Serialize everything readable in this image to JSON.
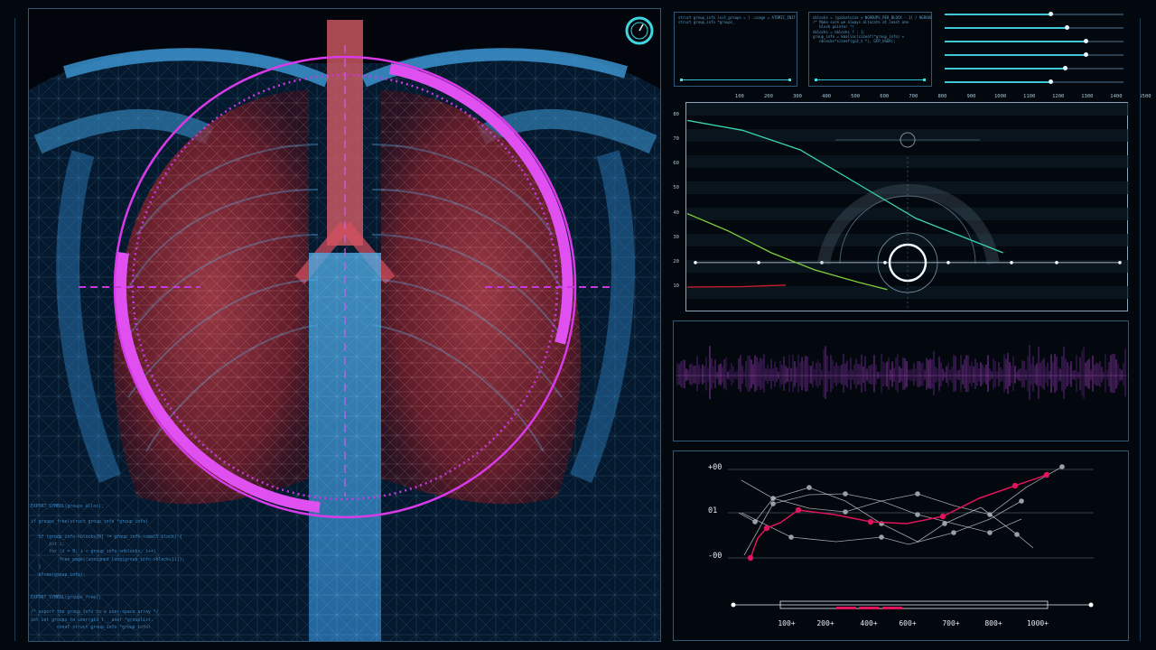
{
  "code": {
    "lines": [
      "EXPORT_SYMBOL(groups_alloc);",
      "",
      "if groups_free(struct group_info *group_info)",
      "",
      "   if (group_info->blocks[0] != group_info->small_block) {",
      "       int i;",
      "       for (i = 0; i < group_info->nblocks; i++)",
      "           free_page((unsigned long)group_info->blocks[i]);",
      "   }",
      "   kfree(group_info);",
      "",
      "",
      "EXPORT_SYMBOL(groups_free);",
      "",
      "/* export the group_info to a user-space array */",
      "int int groups_to_user(gid_t __user *grouplist,",
      "          const struct group_info *group_info)"
    ]
  },
  "terminals": [
    {
      "lines": [
        "struct group_info init_groups = { .usage = ATOMIC_INIT(2) };",
        "struct group_info *groups_"
      ]
    },
    {
      "lines": [
        "nblocks = (gidsetsize + NGROUPS_PER_BLOCK - 1) / NGROUPS_PER_BLOCK;",
        "/* Make sure we always allocate at least one",
        "   block pointer */",
        "nblocks = nblocks ? : 1;",
        "group_info = kmalloc(sizeof(*group_info) +",
        "   nblocks*sizeof(gid_t *), GFP_USER);"
      ]
    }
  ],
  "sliders": [
    0.59,
    0.68,
    0.79,
    0.79,
    0.67,
    0.59
  ],
  "graph": {
    "x_ticks": [
      "100",
      "200",
      "300",
      "400",
      "500",
      "600",
      "700",
      "800",
      "900",
      "1000",
      "1100",
      "1200",
      "1300",
      "1400",
      "1500"
    ],
    "y_ticks": [
      "80",
      "70",
      "60",
      "50",
      "40",
      "30",
      "20",
      "10"
    ],
    "curves": [
      {
        "color": "#38d6b0",
        "points": [
          [
            10,
            78
          ],
          [
            200,
            74
          ],
          [
            400,
            66
          ],
          [
            600,
            52
          ],
          [
            800,
            38
          ],
          [
            1100,
            24
          ]
        ]
      },
      {
        "color": "#7fd13a",
        "points": [
          [
            10,
            40
          ],
          [
            150,
            33
          ],
          [
            300,
            24
          ],
          [
            450,
            17
          ],
          [
            600,
            12
          ],
          [
            700,
            9
          ]
        ]
      },
      {
        "color": "#d02030",
        "points": [
          [
            10,
            10
          ],
          [
            200,
            10.2
          ],
          [
            350,
            10.8
          ]
        ]
      }
    ]
  },
  "bottom_chart": {
    "y_labels": [
      "+00",
      "01",
      "-00"
    ],
    "x_labels": [
      "100+",
      "200+",
      "400+",
      "600+",
      "700+",
      "800+",
      "1000+"
    ],
    "accent_color": "#e0145a"
  }
}
